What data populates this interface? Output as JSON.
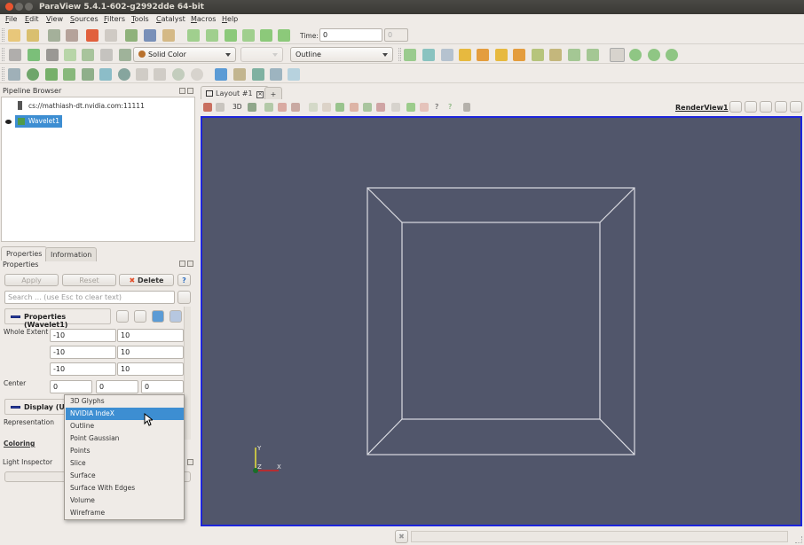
{
  "window": {
    "title": "ParaView 5.4.1-602-g2992dde 64-bit"
  },
  "menu": [
    "File",
    "Edit",
    "View",
    "Sources",
    "Filters",
    "Tools",
    "Catalyst",
    "Macros",
    "Help"
  ],
  "toolbar": {
    "time_label": "Time:",
    "time_value": "0",
    "timestep_value": "0",
    "color_by": "Solid Color",
    "component": "",
    "representation": "Outline"
  },
  "pipeline_browser": {
    "title": "Pipeline Browser",
    "server": "cs://mathiash-dt.nvidia.com:11111",
    "source": "Wavelet1"
  },
  "properties_panel": {
    "tabs": [
      "Properties",
      "Information"
    ],
    "title": "Properties",
    "apply_label": "Apply",
    "reset_label": "Reset",
    "delete_label": "Delete",
    "help_label": "?",
    "search_placeholder": "Search ... (use Esc to clear text)",
    "section_title": "Properties (Wavelet1)",
    "whole_extent_label": "Whole Extent",
    "whole_extent": [
      [
        "-10",
        "10"
      ],
      [
        "-10",
        "10"
      ],
      [
        "-10",
        "10"
      ]
    ],
    "center_label": "Center",
    "center": [
      "0",
      "0",
      "0"
    ],
    "display_section": "Display (Un",
    "representation_label": "Representation",
    "coloring_label": "Coloring",
    "light_inspector": "Light Inspector"
  },
  "representation_menu": {
    "items": [
      "3D Glyphs",
      "NVIDIA IndeX",
      "Outline",
      "Point Gaussian",
      "Points",
      "Slice",
      "Surface",
      "Surface With Edges",
      "Volume",
      "Wireframe"
    ],
    "selected": "NVIDIA IndeX"
  },
  "layout": {
    "tab_label": "Layout #1",
    "add_tab": "+",
    "view_name": "RenderView1",
    "mode_3d": "3D"
  },
  "orientation_axes": {
    "x": "X",
    "y": "Y",
    "z": "Z"
  },
  "colors": {
    "viewport_bg": "#51566b",
    "viewport_border": "#1d25dc",
    "selection": "#3d8ed2"
  }
}
